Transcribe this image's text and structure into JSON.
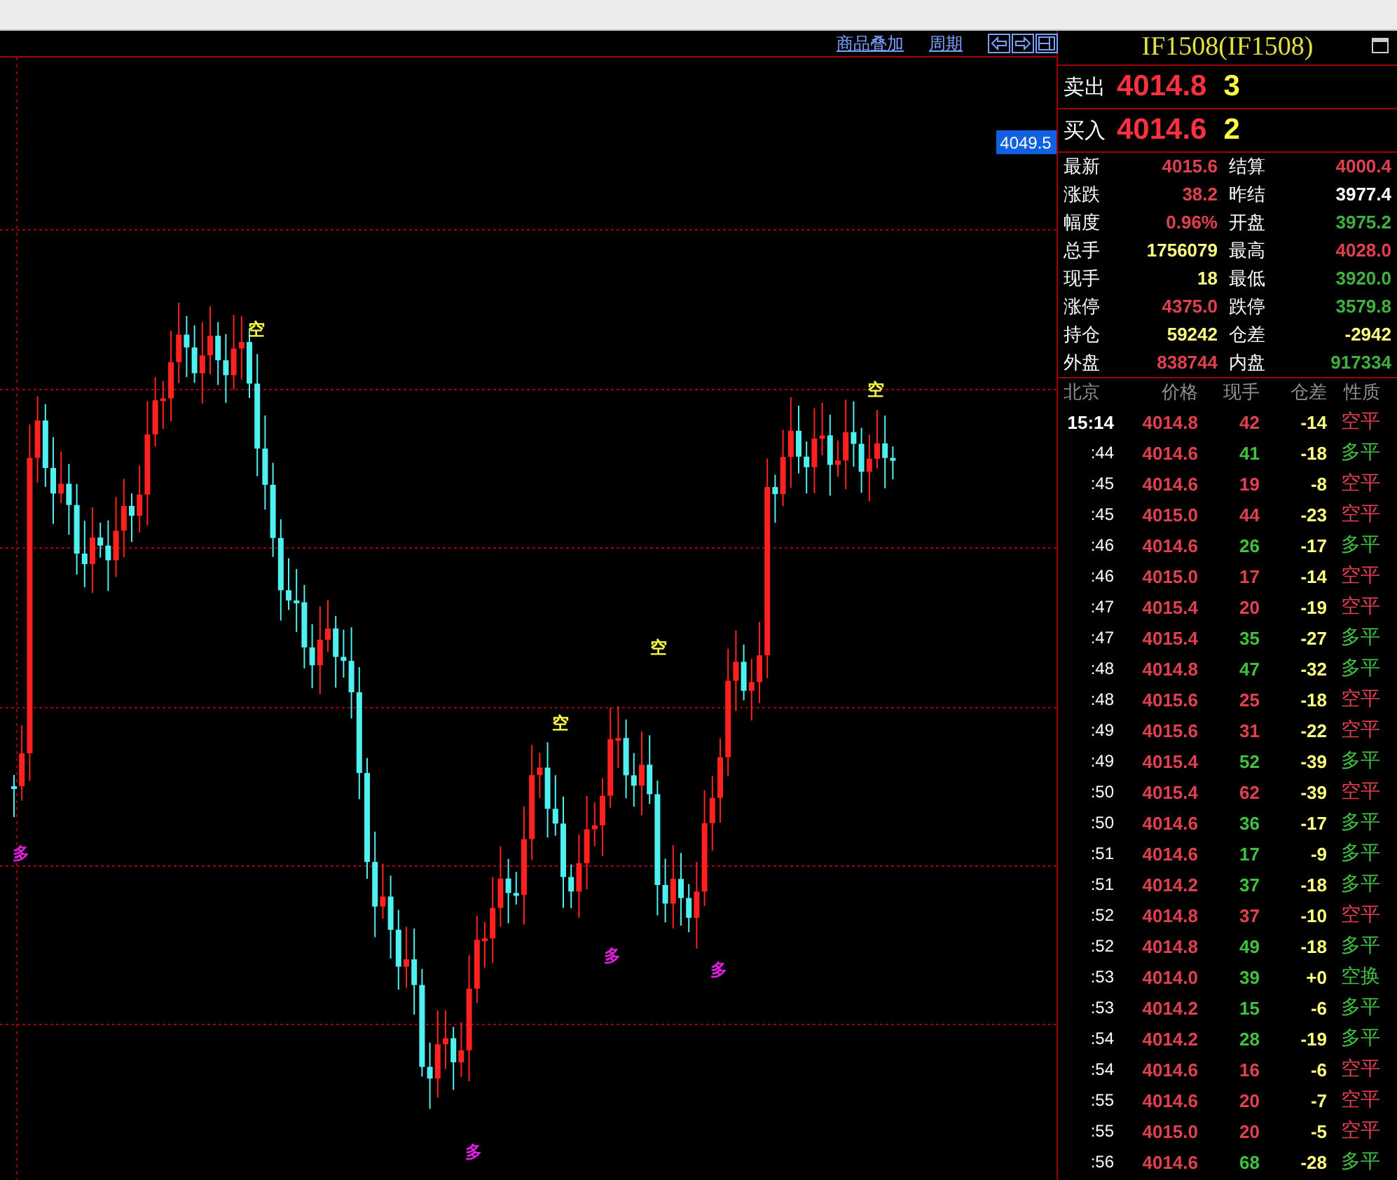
{
  "toolbar": {
    "links": [
      "商品叠加",
      "周期"
    ]
  },
  "chart": {
    "price_label": "4049.5",
    "markers": [
      {
        "text": "空",
        "kind": "short"
      },
      {
        "text": "空",
        "kind": "short"
      },
      {
        "text": "空",
        "kind": "short"
      },
      {
        "text": "空",
        "kind": "short"
      },
      {
        "text": "多",
        "kind": "long"
      },
      {
        "text": "多",
        "kind": "long"
      },
      {
        "text": "多",
        "kind": "long"
      },
      {
        "text": "多",
        "kind": "long"
      }
    ]
  },
  "quote": {
    "title": "IF1508(IF1508)",
    "ask": {
      "label": "卖出",
      "price": "4014.8",
      "size": "3"
    },
    "bid": {
      "label": "买入",
      "price": "4014.6",
      "size": "2"
    },
    "stats": [
      {
        "label": "最新",
        "value": "4015.6",
        "color": "#e04050"
      },
      {
        "label": "结算",
        "value": "4000.4",
        "color": "#e04050"
      },
      {
        "label": "涨跌",
        "value": "38.2",
        "color": "#e04050"
      },
      {
        "label": "昨结",
        "value": "3977.4",
        "color": "#ffffff"
      },
      {
        "label": "幅度",
        "value": "0.96%",
        "color": "#e04050"
      },
      {
        "label": "开盘",
        "value": "3975.2",
        "color": "#40b040"
      },
      {
        "label": "总手",
        "value": "1756079",
        "color": "#ffff80"
      },
      {
        "label": "最高",
        "value": "4028.0",
        "color": "#e04050"
      },
      {
        "label": "现手",
        "value": "18",
        "color": "#ffff80"
      },
      {
        "label": "最低",
        "value": "3920.0",
        "color": "#40b040"
      },
      {
        "label": "涨停",
        "value": "4375.0",
        "color": "#e04050"
      },
      {
        "label": "跌停",
        "value": "3579.8",
        "color": "#40b040"
      },
      {
        "label": "持仓",
        "value": "59242",
        "color": "#ffff80"
      },
      {
        "label": "仓差",
        "value": "-2942",
        "color": "#ffff80"
      },
      {
        "label": "外盘",
        "value": "838744",
        "color": "#e04050"
      },
      {
        "label": "内盘",
        "value": "917334",
        "color": "#40b040"
      }
    ],
    "trade_columns": [
      "北京",
      "价格",
      "现手",
      "仓差",
      "性质"
    ],
    "trades": [
      {
        "time": "15:14",
        "price": "4014.8",
        "volume": "42",
        "change": "-14",
        "nature": "空平",
        "color": "#e04050"
      },
      {
        "time": ":44",
        "price": "4014.6",
        "volume": "41",
        "change": "-18",
        "nature": "多平",
        "color": "#40c040"
      },
      {
        "time": ":45",
        "price": "4014.6",
        "volume": "19",
        "change": "-8",
        "nature": "空平",
        "color": "#e04050"
      },
      {
        "time": ":45",
        "price": "4015.0",
        "volume": "44",
        "change": "-23",
        "nature": "空平",
        "color": "#e04050"
      },
      {
        "time": ":46",
        "price": "4014.6",
        "volume": "26",
        "change": "-17",
        "nature": "多平",
        "color": "#40c040"
      },
      {
        "time": ":46",
        "price": "4015.0",
        "volume": "17",
        "change": "-14",
        "nature": "空平",
        "color": "#e04050"
      },
      {
        "time": ":47",
        "price": "4015.4",
        "volume": "20",
        "change": "-19",
        "nature": "空平",
        "color": "#e04050"
      },
      {
        "time": ":47",
        "price": "4015.4",
        "volume": "35",
        "change": "-27",
        "nature": "多平",
        "color": "#40c040"
      },
      {
        "time": ":48",
        "price": "4014.8",
        "volume": "47",
        "change": "-32",
        "nature": "多平",
        "color": "#40c040"
      },
      {
        "time": ":48",
        "price": "4015.6",
        "volume": "25",
        "change": "-18",
        "nature": "空平",
        "color": "#e04050"
      },
      {
        "time": ":49",
        "price": "4015.6",
        "volume": "31",
        "change": "-22",
        "nature": "空平",
        "color": "#e04050"
      },
      {
        "time": ":49",
        "price": "4015.4",
        "volume": "52",
        "change": "-39",
        "nature": "多平",
        "color": "#40c040"
      },
      {
        "time": ":50",
        "price": "4015.4",
        "volume": "62",
        "change": "-39",
        "nature": "空平",
        "color": "#e04050"
      },
      {
        "time": ":50",
        "price": "4014.6",
        "volume": "36",
        "change": "-17",
        "nature": "多平",
        "color": "#40c040"
      },
      {
        "time": ":51",
        "price": "4014.6",
        "volume": "17",
        "change": "-9",
        "nature": "多平",
        "color": "#40c040"
      },
      {
        "time": ":51",
        "price": "4014.2",
        "volume": "37",
        "change": "-18",
        "nature": "多平",
        "color": "#40c040"
      },
      {
        "time": ":52",
        "price": "4014.8",
        "volume": "37",
        "change": "-10",
        "nature": "空平",
        "color": "#e04050"
      },
      {
        "time": ":52",
        "price": "4014.8",
        "volume": "49",
        "change": "-18",
        "nature": "多平",
        "color": "#40c040"
      },
      {
        "time": ":53",
        "price": "4014.0",
        "volume": "39",
        "change": "+0",
        "nature": "空换",
        "color": "#40c040"
      },
      {
        "time": ":53",
        "price": "4014.2",
        "volume": "15",
        "change": "-6",
        "nature": "多平",
        "color": "#40c040"
      },
      {
        "time": ":54",
        "price": "4014.2",
        "volume": "28",
        "change": "-19",
        "nature": "多平",
        "color": "#40c040"
      },
      {
        "time": ":54",
        "price": "4014.6",
        "volume": "16",
        "change": "-6",
        "nature": "空平",
        "color": "#e04050"
      },
      {
        "time": ":55",
        "price": "4014.6",
        "volume": "20",
        "change": "-7",
        "nature": "空平",
        "color": "#e04050"
      },
      {
        "time": ":55",
        "price": "4015.0",
        "volume": "20",
        "change": "-5",
        "nature": "空平",
        "color": "#e04050"
      },
      {
        "time": ":56",
        "price": "4014.6",
        "volume": "68",
        "change": "-28",
        "nature": "多平",
        "color": "#40c040"
      }
    ]
  }
}
